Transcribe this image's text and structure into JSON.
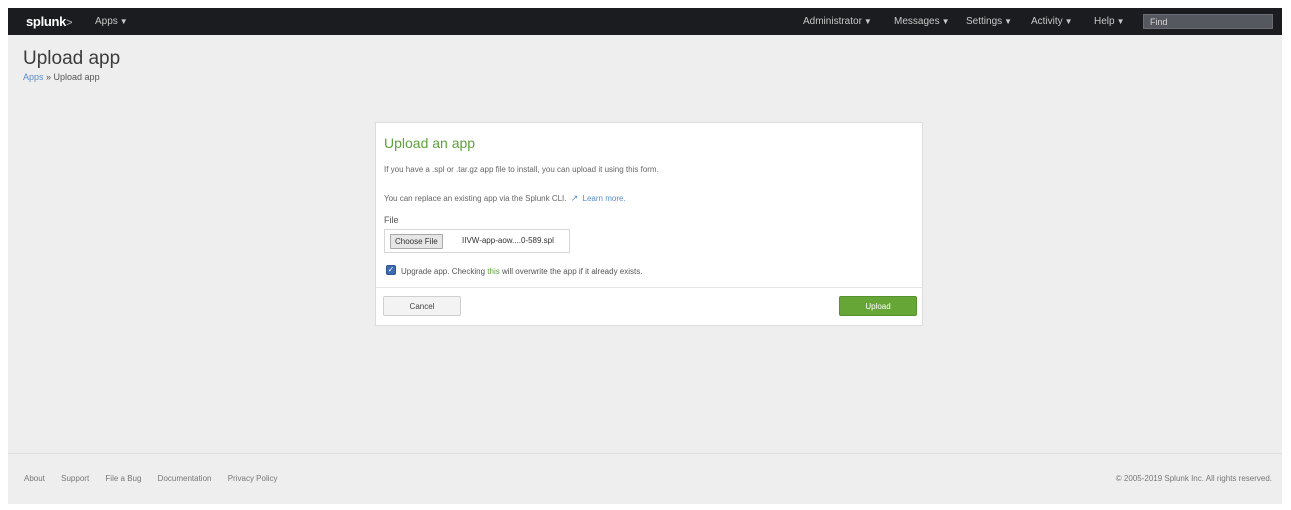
{
  "topbar": {
    "logo": "splunk",
    "logo_mark": ">",
    "apps_label": "Apps",
    "nav": [
      {
        "label": "Administrator"
      },
      {
        "label": "Messages"
      },
      {
        "label": "Settings"
      },
      {
        "label": "Activity"
      },
      {
        "label": "Help"
      }
    ],
    "find_placeholder": "Find"
  },
  "page": {
    "title": "Upload app",
    "breadcrumb_link": "Apps",
    "breadcrumb_sep": " » ",
    "breadcrumb_current": "Upload app"
  },
  "panel": {
    "title": "Upload an app",
    "intro": "If you have a .spl or .tar.gz app file to install, you can upload it using this form.",
    "replace_text": "You can replace an existing app via the Splunk CLI.",
    "learn_more": "Learn more.",
    "file_label": "File",
    "choose_file": "Choose File",
    "file_name": "IIVW-app-aow....0-589.spl",
    "upgrade_prefix": "Upgrade app. Checking ",
    "upgrade_highlight": "this",
    "upgrade_suffix": " will overwrite the app if it already exists.",
    "upgrade_checked": true,
    "cancel": "Cancel",
    "upload": "Upload"
  },
  "footer": {
    "links": [
      "About",
      "Support",
      "File a Bug",
      "Documentation",
      "Privacy Policy"
    ],
    "copyright": "© 2005-2019 Splunk Inc. All rights reserved."
  },
  "colors": {
    "accent_green": "#65a637",
    "link_blue": "#5a8ec9",
    "topbar": "#1a1c20"
  }
}
